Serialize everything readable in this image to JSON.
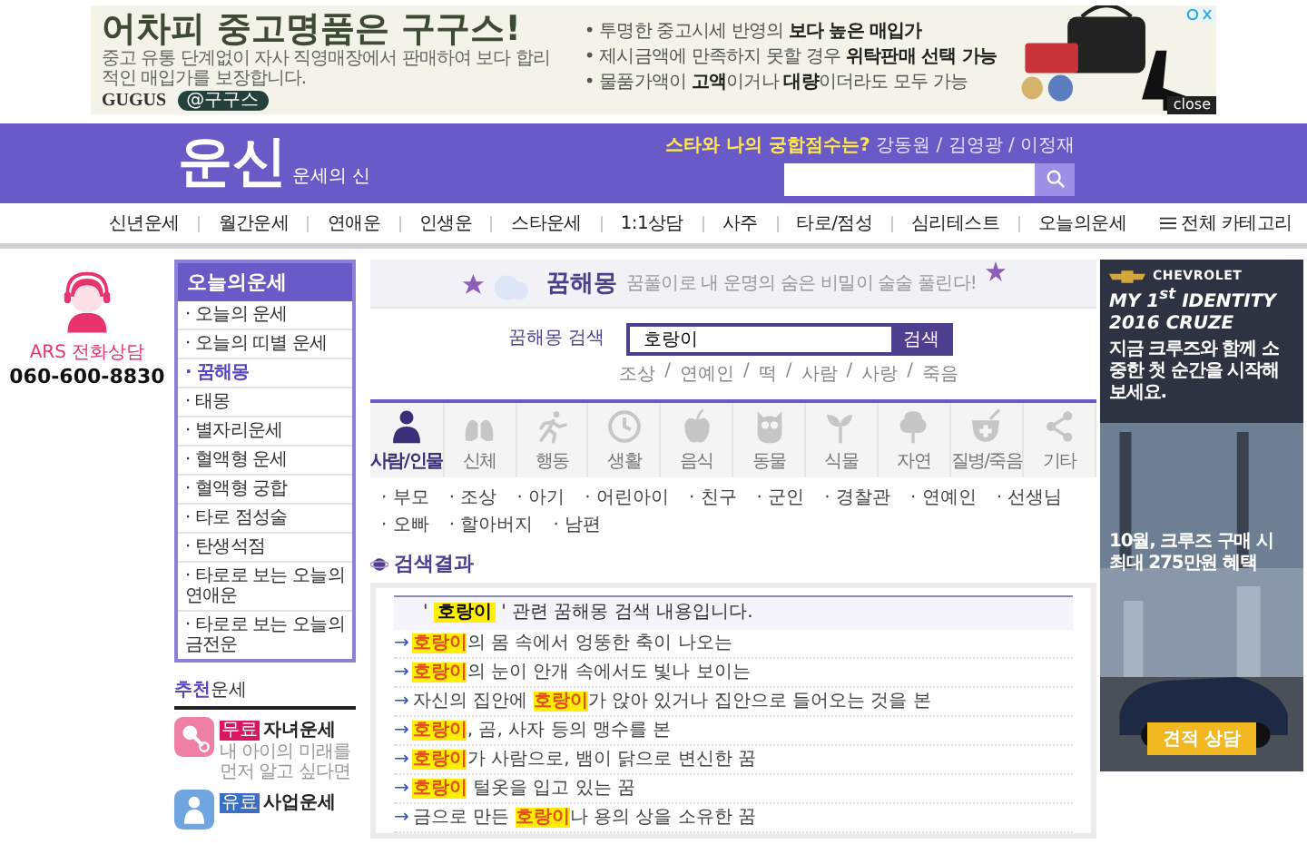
{
  "top_ad": {
    "headline": "어차피 중고명품은 구구스!",
    "subtitle": "중고 유통 단계없이 자사 직영매장에서 판매하여 보다 합리적인 매입가를 보장합니다.",
    "brand": "GUGUS",
    "badge": "@구구스",
    "bullets": [
      "• 투명한 중고시세 반영의 **보다 높은 매입가**",
      "• 제시금액에 만족하지 못할 경우 **위탁판매 선택 가능**",
      "• 물품가액이 **고액**이거나 **대량**이더라도 모두 가능"
    ],
    "close": "close"
  },
  "header": {
    "logo": "운신",
    "logo_sub": "운세의 신",
    "promo": "**스타와 나의 궁합점수는?** 강동원 / 김영광 / 이정재"
  },
  "nav": [
    "신년운세",
    "월간운세",
    "연애운",
    "인생운",
    "스타운세",
    "1:1상담",
    "사주",
    "타로/점성",
    "심리테스트",
    "오늘의운세"
  ],
  "all_categories": "전체 카테고리",
  "ars": {
    "label": "ARS 전화상담",
    "phone": "060-600-8830"
  },
  "sidebar": {
    "title": "오늘의운세",
    "items": [
      {
        "label": "· 오늘의 운세",
        "selected": false
      },
      {
        "label": "· 오늘의 띠별 운세",
        "selected": false
      },
      {
        "label": "· 꿈해몽",
        "selected": true
      },
      {
        "label": "· 태몽",
        "selected": false
      },
      {
        "label": "· 별자리운세",
        "selected": false
      },
      {
        "label": "· 혈액형 운세",
        "selected": false
      },
      {
        "label": "· 혈액형 궁합",
        "selected": false
      },
      {
        "label": "· 타로 점성술",
        "selected": false
      },
      {
        "label": "· 탄생석점",
        "selected": false
      },
      {
        "label": "· 타로로 보는 오늘의 연애운",
        "selected": false
      },
      {
        "label": "· 타로로 보는 오늘의 금전운",
        "selected": false
      }
    ]
  },
  "recommend": {
    "title_accent": "추천",
    "title_rest": "운세",
    "cards": [
      {
        "badge": "무료",
        "color": "#d8175f",
        "title": "자녀운세",
        "desc": "내 아이의 미래를 먼저 알고 싶다면"
      },
      {
        "badge": "유료",
        "color": "#3a6fc4",
        "title": "사업운세"
      }
    ]
  },
  "dream": {
    "banner_title": "꿈해몽",
    "banner_text": "꿈풀이로 내 운명의 숨은 비밀이 술술 풀린다!",
    "search_label": "꿈해몽 검색",
    "search_value": "호랑이",
    "search_button": "검색",
    "tag_separator": "/",
    "tags": [
      "조상",
      "연예인",
      "떡",
      "사람",
      "사랑",
      "죽음"
    ],
    "categories": [
      {
        "label": "사람/인물",
        "selected": true
      },
      {
        "label": "신체",
        "selected": false
      },
      {
        "label": "행동",
        "selected": false
      },
      {
        "label": "생활",
        "selected": false
      },
      {
        "label": "음식",
        "selected": false
      },
      {
        "label": "동물",
        "selected": false
      },
      {
        "label": "식물",
        "selected": false
      },
      {
        "label": "자연",
        "selected": false
      },
      {
        "label": "질병/죽음",
        "selected": false
      },
      {
        "label": "기타",
        "selected": false
      }
    ],
    "sub_items": [
      "· 부모",
      "· 조상",
      "· 아기",
      "· 어린아이",
      "· 친구",
      "· 군인",
      "· 경찰관",
      "· 연예인",
      "· 선생님",
      "· 오빠",
      "· 할아버지",
      "· 남편"
    ],
    "results_title": "검색결과",
    "results_header": "' **호랑이** ' 관련 꿈해몽 검색 내용입니다.",
    "results": [
      {
        "arrow": "→",
        "text": "**호랑이**의 몸 속에서 엉뚱한 축이 나오는"
      },
      {
        "arrow": "→",
        "text": "**호랑이**의 눈이 안개 속에서도 빛나 보이는"
      },
      {
        "arrow": "→",
        "text": "자신의 집안에 **호랑이**가 앉아 있거나 집안으로 들어오는 것을 본"
      },
      {
        "arrow": "→",
        "text": "**호랑이**, 곰, 사자 등의 맹수를 본"
      },
      {
        "arrow": "→",
        "text": "**호랑이**가 사람으로, 뱀이 닭으로 변신한 꿈"
      },
      {
        "arrow": "→",
        "text": "**호랑이** 털옷을 입고 있는 꿈"
      },
      {
        "arrow": "→",
        "text": "금으로 만든 **호랑이**나 용의 상을 소유한 꿈"
      }
    ]
  },
  "side_ad": {
    "brand": "CHEVROLET",
    "headline": "MY 1$^{st}$ IDENTITY",
    "model": "2016 CRUZE",
    "copy": "지금 크루즈와 함께 소중한 첫 순간을 시작해 보세요.",
    "offer": "10월, 크루즈 구매 시 최대 275만원 혜택",
    "button": "견적 상담"
  }
}
